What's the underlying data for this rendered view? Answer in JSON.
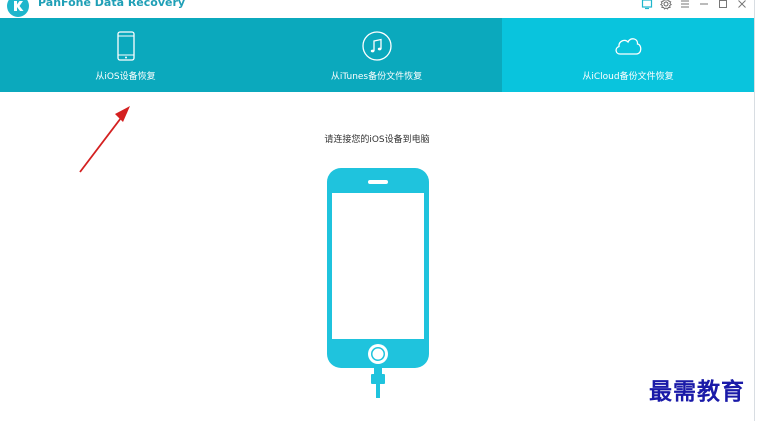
{
  "app": {
    "title": "PanFone Data Recovery"
  },
  "window_controls": [
    {
      "name": "feedback-icon"
    },
    {
      "name": "settings-icon"
    },
    {
      "name": "menu-icon"
    },
    {
      "name": "minimize-icon"
    },
    {
      "name": "maximize-icon"
    },
    {
      "name": "close-icon"
    }
  ],
  "tabs": [
    {
      "label": "从iOS设备恢复",
      "icon": "phone-icon",
      "active": true
    },
    {
      "label": "从iTunes备份文件恢复",
      "icon": "music-note-icon",
      "active": false
    },
    {
      "label": "从iCloud备份文件恢复",
      "icon": "cloud-icon",
      "active": false
    }
  ],
  "main": {
    "prompt": "请连接您的iOS设备到电脑",
    "illustration_icon": "iphone-with-cable-icon"
  },
  "annotation": {
    "arrow_icon": "red-arrow-icon",
    "color": "#d42020"
  },
  "watermark": {
    "text": "最需教育"
  },
  "colors": {
    "tab_bg": "#0ba9bd",
    "tab_bg_highlight": "#09c4dd",
    "accent": "#1fc3dd",
    "title_text": "#1f9fb6"
  }
}
